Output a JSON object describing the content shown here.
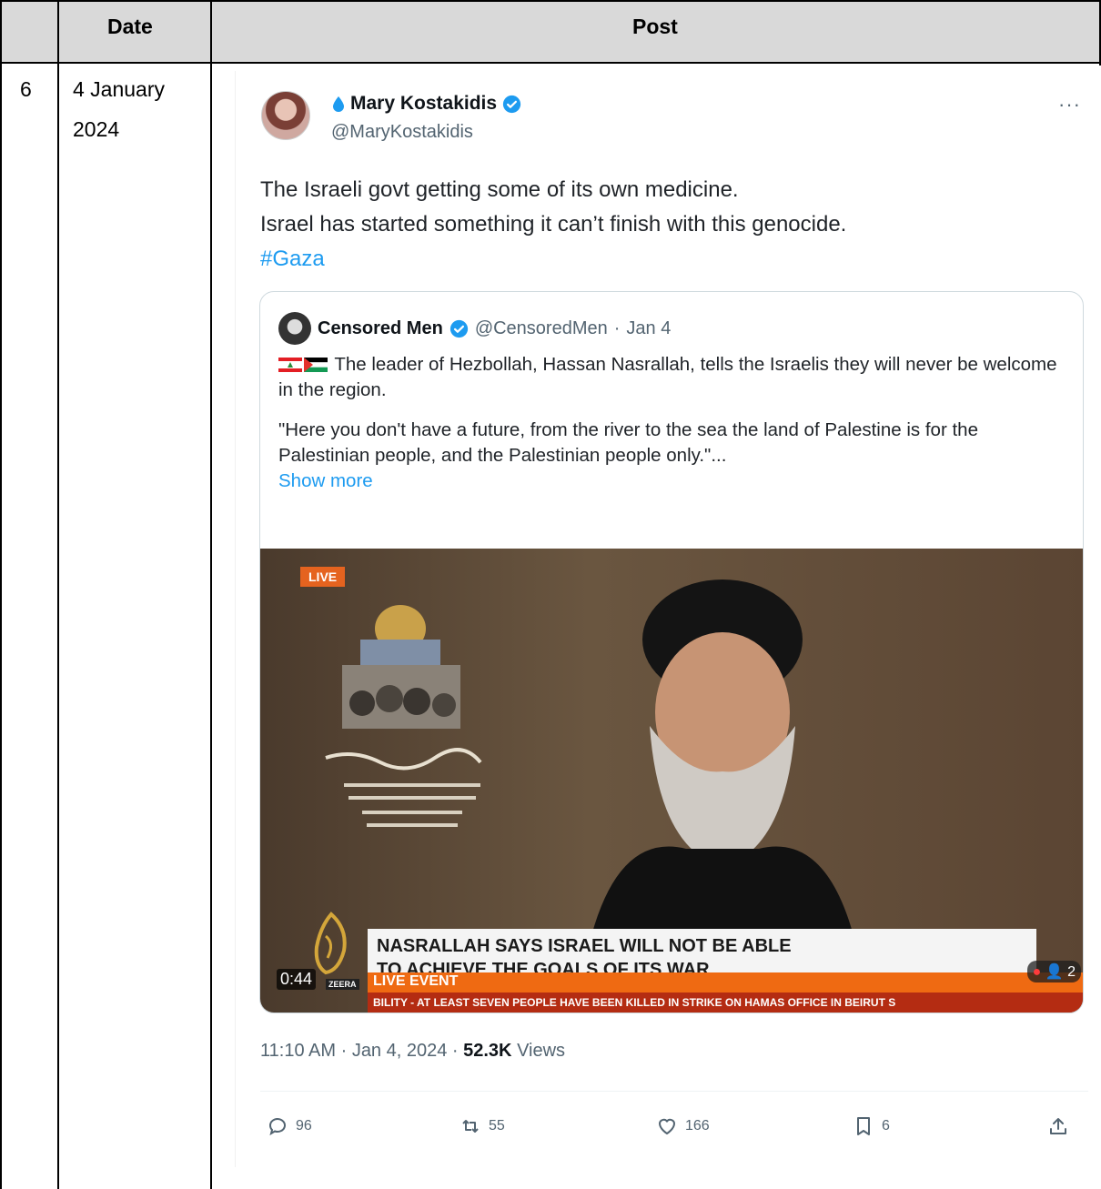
{
  "table": {
    "headers": [
      "",
      "Date",
      "Post"
    ],
    "row": {
      "number": "6",
      "date_line1": "4 January",
      "date_line2": "2024"
    }
  },
  "tweet": {
    "author_name": "Mary Kostakidis",
    "author_handle": "@MaryKostakidis",
    "more_label": "···",
    "text_line1": "The Israeli govt getting some of its own medicine.",
    "text_line2": "Israel has started something it can’t finish with this genocide.",
    "hashtag": "#Gaza",
    "quoted": {
      "name": "Censored Men",
      "handle": "@CensoredMen",
      "date": "Jan 4",
      "text1": "The leader of Hezbollah, Hassan Nasrallah, tells the Israelis they will never be welcome in the region.",
      "text2": "\"Here you don't have a future, from the river to the sea the land of Palestine is for the Palestinian people, and the Palestinian people only.\"...",
      "show_more": "Show more",
      "video": {
        "live_tag": "LIVE",
        "headline_line1": "NASRALLAH SAYS ISRAEL WILL NOT BE ABLE",
        "headline_line2": "TO ACHIEVE THE GOALS OF ITS WAR",
        "live_event": "LIVE EVENT",
        "ticker": "BILITY  -  AT LEAST SEVEN PEOPLE HAVE BEEN KILLED IN STRIKE ON HAMAS OFFICE IN BEIRUT S",
        "duration": "0:44",
        "network_badge": "ZEERA",
        "viewers": "2"
      }
    },
    "time": "11:10 AM",
    "date": "Jan 4, 2024",
    "views_count": "52.3K",
    "views_label": "Views",
    "replies": "96",
    "reposts": "55",
    "likes": "166",
    "bookmarks": "6",
    "colors": {
      "link": "#1d9bf0",
      "muted": "#536471",
      "verified": "#1d9bf0",
      "header_bg": "#d9d9d9"
    }
  }
}
